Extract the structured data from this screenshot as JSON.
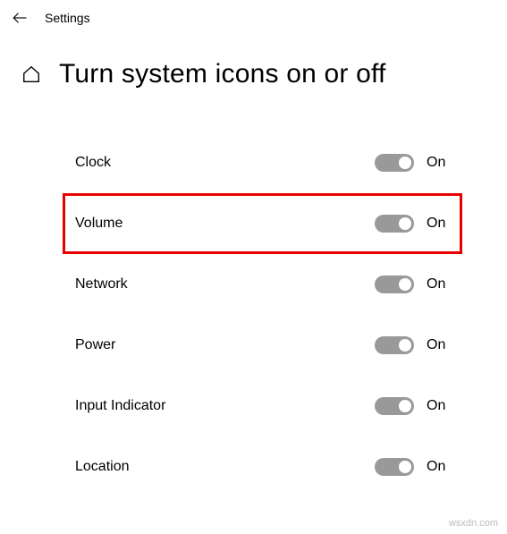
{
  "header": {
    "app_title": "Settings"
  },
  "page": {
    "title": "Turn system icons on or off"
  },
  "items": [
    {
      "label": "Clock",
      "state": "On",
      "highlighted": false
    },
    {
      "label": "Volume",
      "state": "On",
      "highlighted": true
    },
    {
      "label": "Network",
      "state": "On",
      "highlighted": false
    },
    {
      "label": "Power",
      "state": "On",
      "highlighted": false
    },
    {
      "label": "Input Indicator",
      "state": "On",
      "highlighted": false
    },
    {
      "label": "Location",
      "state": "On",
      "highlighted": false
    }
  ],
  "watermark": "wsxdn.com",
  "colors": {
    "highlight_border": "#e60000",
    "toggle_track": "#999999",
    "toggle_thumb": "#ffffff"
  }
}
